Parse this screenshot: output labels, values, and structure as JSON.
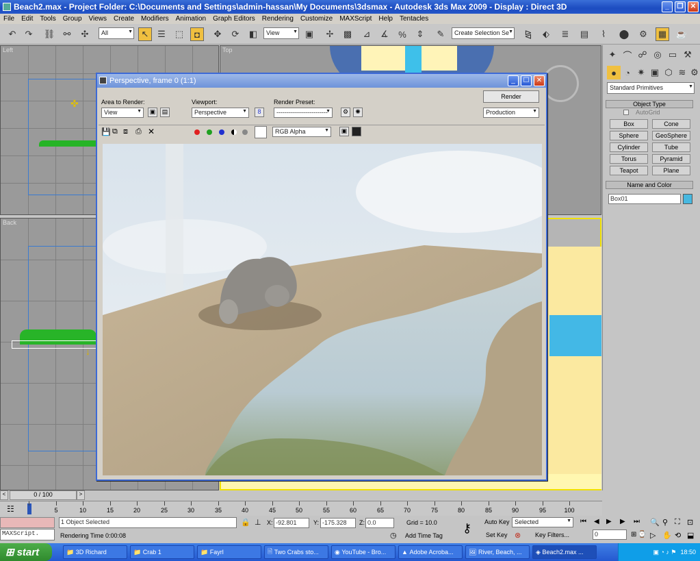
{
  "window": {
    "title": "Beach2.max     - Project Folder: C:\\Documents and Settings\\admin-hassan\\My Documents\\3dsmax     - Autodesk 3ds Max  2009     - Display : Direct 3D"
  },
  "menu": [
    "File",
    "Edit",
    "Tools",
    "Group",
    "Views",
    "Create",
    "Modifiers",
    "Animation",
    "Graph Editors",
    "Rendering",
    "Customize",
    "MAXScript",
    "Help",
    "Tentacles"
  ],
  "toolbar": {
    "filter_value": "All",
    "coord_value": "View",
    "selection_set_placeholder": "Create Selection Se"
  },
  "viewports": {
    "top_left": "Left",
    "top_right": "Top",
    "bottom_left": "Back"
  },
  "render_window": {
    "title": "Perspective, frame 0 (1:1)",
    "area_label": "Area to Render:",
    "area_value": "View",
    "viewport_label": "Viewport:",
    "viewport_value": "Perspective",
    "preset_label": "Render Preset:",
    "preset_value": "-------------------------",
    "render_button": "Render",
    "mode_value": "Production",
    "channel_value": "RGB Alpha"
  },
  "command_panel": {
    "category_value": "Standard Primitives",
    "object_type_header": "Object Type",
    "autogrid_label": "AutoGrid",
    "primitives": [
      "Box",
      "Cone",
      "Sphere",
      "GeoSphere",
      "Cylinder",
      "Tube",
      "Torus",
      "Pyramid",
      "Teapot",
      "Plane"
    ],
    "name_color_header": "Name and Color",
    "object_name": "Box01",
    "object_color": "#47b8e0"
  },
  "timeline": {
    "frame_counter": "0 / 100",
    "ticks": [
      "0",
      "5",
      "10",
      "15",
      "20",
      "25",
      "30",
      "35",
      "40",
      "45",
      "50",
      "55",
      "60",
      "65",
      "70",
      "75",
      "80",
      "85",
      "90",
      "95",
      "100"
    ]
  },
  "status": {
    "maxscript_label": "MAXScript.",
    "selection_status": "1 Object Selected",
    "render_time": "Rendering Time  0:00:08",
    "x_label": "X:",
    "x_value": "-92.801",
    "y_label": "Y:",
    "y_value": "-175.328",
    "z_label": "Z:",
    "z_value": "0.0",
    "grid_label": "Grid = 10.0",
    "add_time_tag": "Add Time Tag",
    "auto_key": "Auto Key",
    "set_key": "Set Key",
    "key_mode_value": "Selected",
    "key_filters": "Key Filters...",
    "current_frame": "0"
  },
  "taskbar": {
    "start": "start",
    "items": [
      "3D Richard",
      "Crab 1",
      "Fayrl",
      "Two Crabs sto...",
      "YouTube - Bro...",
      "Adobe Acroba...",
      "River, Beach, ...",
      "Beach2.max  ..."
    ],
    "clock": "18:50"
  }
}
